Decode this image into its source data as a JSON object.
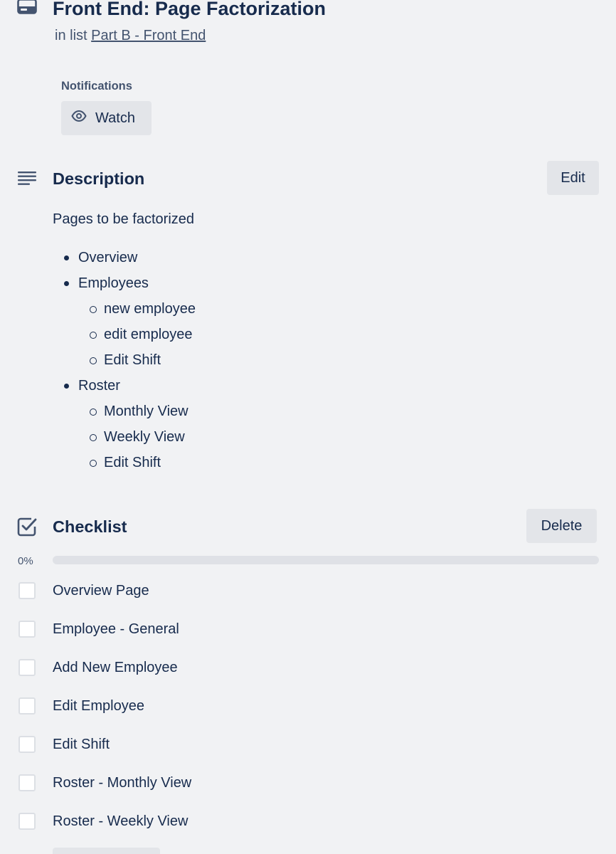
{
  "card": {
    "title": "Front End: Page Factorization",
    "in_list_prefix": "in list",
    "list_name": "Part B - Front End"
  },
  "notifications": {
    "label": "Notifications",
    "watch_label": "Watch"
  },
  "description": {
    "title": "Description",
    "edit_label": "Edit",
    "intro": "Pages to be factorized",
    "items": [
      {
        "level": 1,
        "text": "Overview"
      },
      {
        "level": 1,
        "text": "Employees"
      },
      {
        "level": 2,
        "text": "new employee"
      },
      {
        "level": 2,
        "text": "edit employee"
      },
      {
        "level": 2,
        "text": "Edit Shift"
      },
      {
        "level": 1,
        "text": "Roster"
      },
      {
        "level": 2,
        "text": "Monthly View"
      },
      {
        "level": 2,
        "text": "Weekly View"
      },
      {
        "level": 2,
        "text": "Edit Shift"
      }
    ]
  },
  "checklist": {
    "title": "Checklist",
    "delete_label": "Delete",
    "progress_text": "0%",
    "progress_fraction": 0,
    "items": [
      {
        "label": "Overview Page",
        "checked": false
      },
      {
        "label": "Employee - General",
        "checked": false
      },
      {
        "label": "Add New Employee",
        "checked": false
      },
      {
        "label": "Edit Employee",
        "checked": false
      },
      {
        "label": "Edit Shift",
        "checked": false
      },
      {
        "label": "Roster - Monthly View",
        "checked": false
      },
      {
        "label": "Roster - Weekly View",
        "checked": false
      }
    ]
  },
  "colors": {
    "background": "#f1f2f4",
    "text": "#172b4d",
    "subtle_text": "#44546f",
    "button_bg": "#e3e5e9"
  },
  "icons": {
    "card": "card-icon",
    "watch": "eye-icon",
    "description": "description-lines-icon",
    "checklist": "checkbox-checked-icon"
  }
}
